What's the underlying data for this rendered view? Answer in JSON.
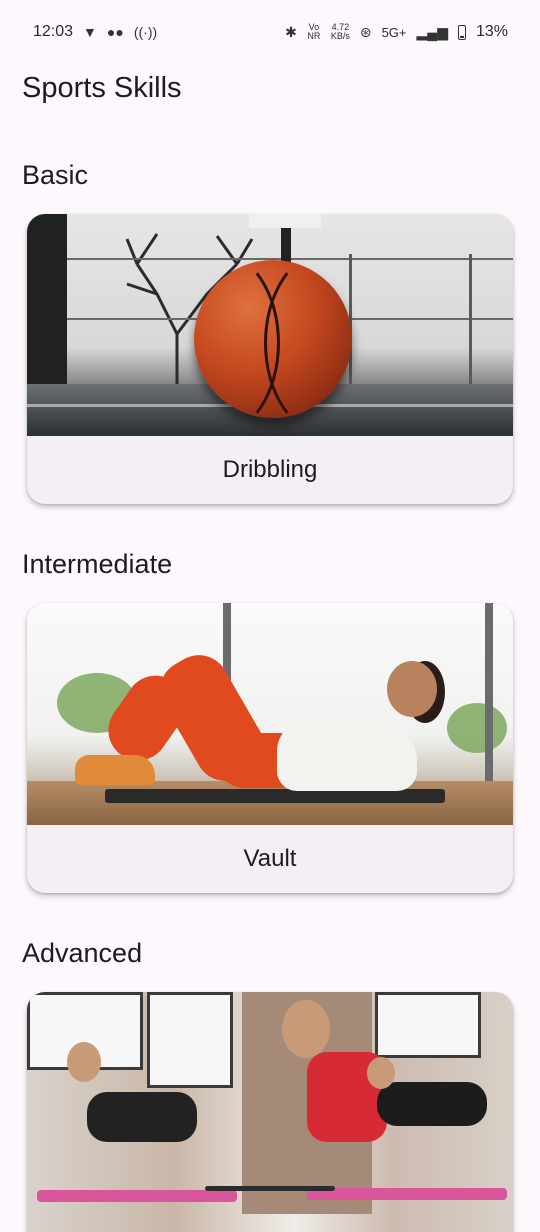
{
  "status_bar": {
    "time": "12:03",
    "left_icons": [
      "vpn-shield-icon",
      "incognito-icon",
      "hotspot-icon"
    ],
    "net_speed_value": "4.72",
    "net_speed_unit": "KB/s",
    "vonr_label": "Vo NR",
    "network": "5G+",
    "battery_percent": "13%"
  },
  "app": {
    "title": "Sports Skills"
  },
  "sections": [
    {
      "title": "Basic",
      "card_label": "Dribbling",
      "image": "basketball-on-court"
    },
    {
      "title": "Intermediate",
      "card_label": "Vault",
      "image": "woman-doing-crunches"
    },
    {
      "title": "Advanced",
      "card_label": "",
      "image": "group-workout-class"
    }
  ],
  "colors": {
    "background": "#fdf8fd",
    "card_surface": "#f4eff4",
    "text_primary": "#1c1b1f"
  }
}
